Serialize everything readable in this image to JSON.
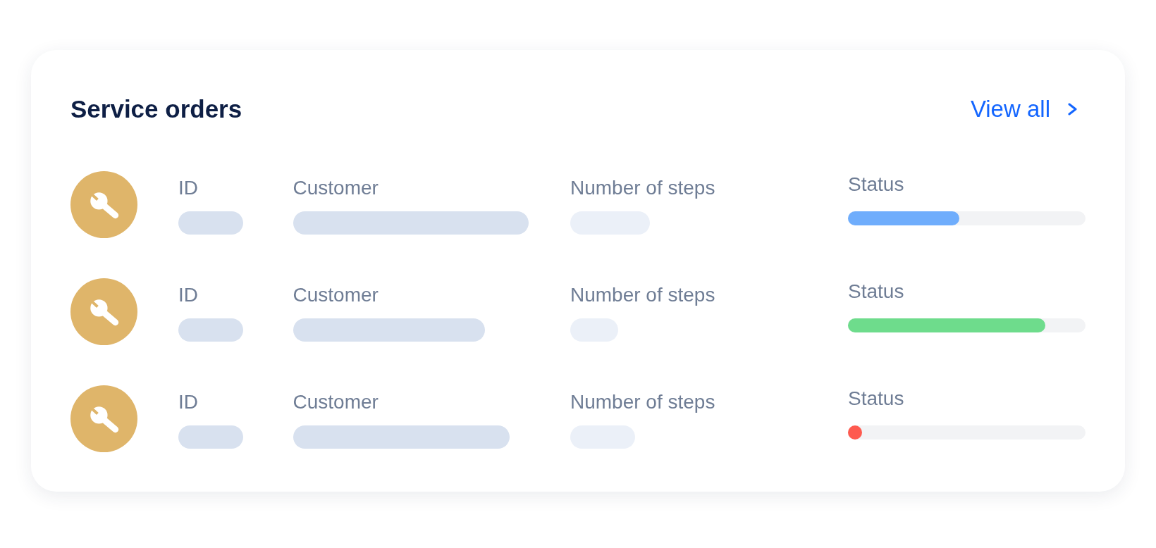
{
  "card": {
    "title": "Service orders",
    "view_all_link": "View all"
  },
  "rows": [
    {
      "id_label": "ID",
      "customer_label": "Customer",
      "steps_label": "Number of steps",
      "status_label": "Status",
      "status": {
        "level": 0.47,
        "color": "#6fadfc"
      }
    },
    {
      "id_label": "ID",
      "customer_label": "Customer",
      "steps_label": "Number of steps",
      "status_label": "Status",
      "status": {
        "level": 0.83,
        "color": "#6edc8c"
      }
    },
    {
      "id_label": "ID",
      "customer_label": "Customer",
      "steps_label": "Number of steps",
      "status_label": "Status",
      "status": {
        "level": 0.06,
        "color": "#fe5a4f"
      }
    }
  ]
}
